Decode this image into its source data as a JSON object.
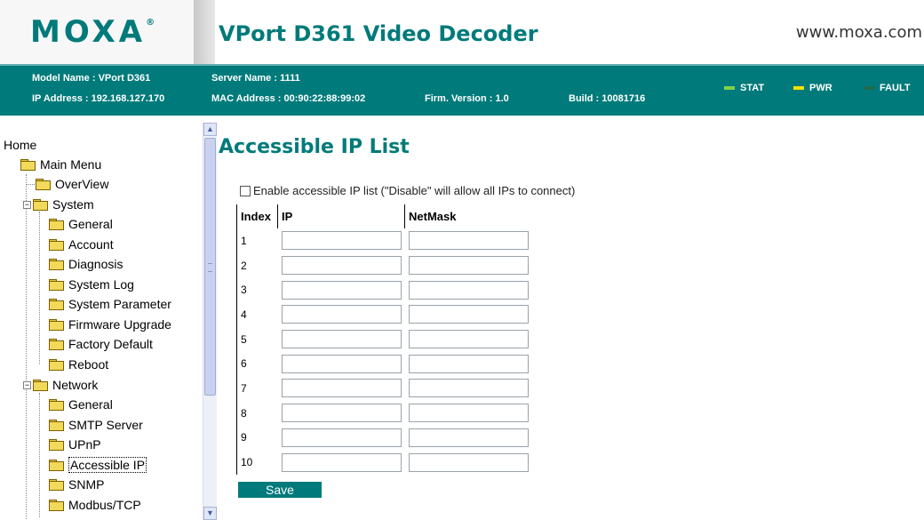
{
  "header": {
    "logo_text": "MOXA",
    "logo_mark": "®",
    "product_title": "VPort D361 Video Decoder",
    "website": "www.moxa.com"
  },
  "info_bar": {
    "model_name": "Model Name : VPort D361",
    "server_name": "Server Name : 1111",
    "ip_address": "IP Address : 192.168.127.170",
    "mac_address": "MAC Address : 00:90:22:88:99:02",
    "firmware_version": "Firm. Version : 1.0",
    "build": "Build : 10081716",
    "leds": [
      {
        "label": "STAT",
        "color": "#7fd24a"
      },
      {
        "label": "PWR",
        "color": "#f5e200"
      },
      {
        "label": "FAULT",
        "color": "#1f6b4e"
      }
    ]
  },
  "sidebar": {
    "home": "Home",
    "main_menu": "Main Menu",
    "overview": "OverView",
    "system": {
      "label": "System",
      "items": [
        "General",
        "Account",
        "Diagnosis",
        "System Log",
        "System Parameter",
        "Firmware Upgrade",
        "Factory Default",
        "Reboot"
      ]
    },
    "network": {
      "label": "Network",
      "items": [
        "General",
        "SMTP Server",
        "UPnP",
        "Accessible IP",
        "SNMP",
        "Modbus/TCP"
      ]
    },
    "selected": "Accessible IP",
    "colors": {
      "folder": "#f2d95a"
    }
  },
  "main": {
    "title": "Accessible IP List",
    "enable_label": "Enable accessible IP list (\"Disable\" will allow all IPs to connect)",
    "enable_checked": false,
    "table": {
      "headers": [
        "Index",
        "IP",
        "NetMask"
      ],
      "rows": [
        {
          "index": "1",
          "ip": "",
          "netmask": ""
        },
        {
          "index": "2",
          "ip": "",
          "netmask": ""
        },
        {
          "index": "3",
          "ip": "",
          "netmask": ""
        },
        {
          "index": "4",
          "ip": "",
          "netmask": ""
        },
        {
          "index": "5",
          "ip": "",
          "netmask": ""
        },
        {
          "index": "6",
          "ip": "",
          "netmask": ""
        },
        {
          "index": "7",
          "ip": "",
          "netmask": ""
        },
        {
          "index": "8",
          "ip": "",
          "netmask": ""
        },
        {
          "index": "9",
          "ip": "",
          "netmask": ""
        },
        {
          "index": "10",
          "ip": "",
          "netmask": ""
        }
      ]
    },
    "save_label": "Save"
  },
  "theme": {
    "brand": "#007a7a",
    "text": "#000000"
  }
}
